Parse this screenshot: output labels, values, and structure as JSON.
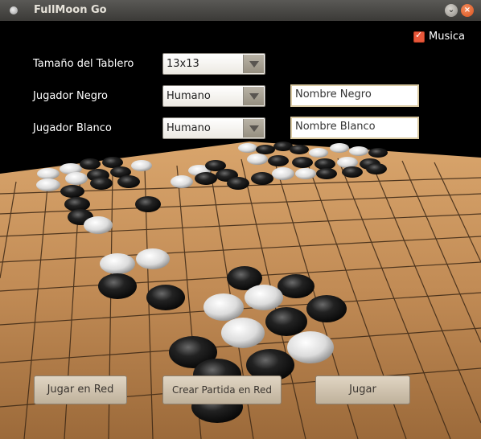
{
  "window": {
    "title": "FullMoon Go"
  },
  "options": {
    "music_label": "Musica",
    "music_checked": true
  },
  "form": {
    "board_size_label": "Tamaño del Tablero",
    "board_size_value": "13x13",
    "black_player_label": "Jugador Negro",
    "black_player_value": "Humano",
    "black_name_value": "Nombre Negro",
    "white_player_label": "Jugador Blanco",
    "white_player_value": "Humano",
    "white_name_value": "Nombre Blanco"
  },
  "buttons": {
    "play_network": "Jugar en Red",
    "create_network_game": "Crear Partida en Red",
    "play": "Jugar"
  },
  "colors": {
    "board_wood": "#b88654",
    "accent_close": "#e65a28"
  }
}
